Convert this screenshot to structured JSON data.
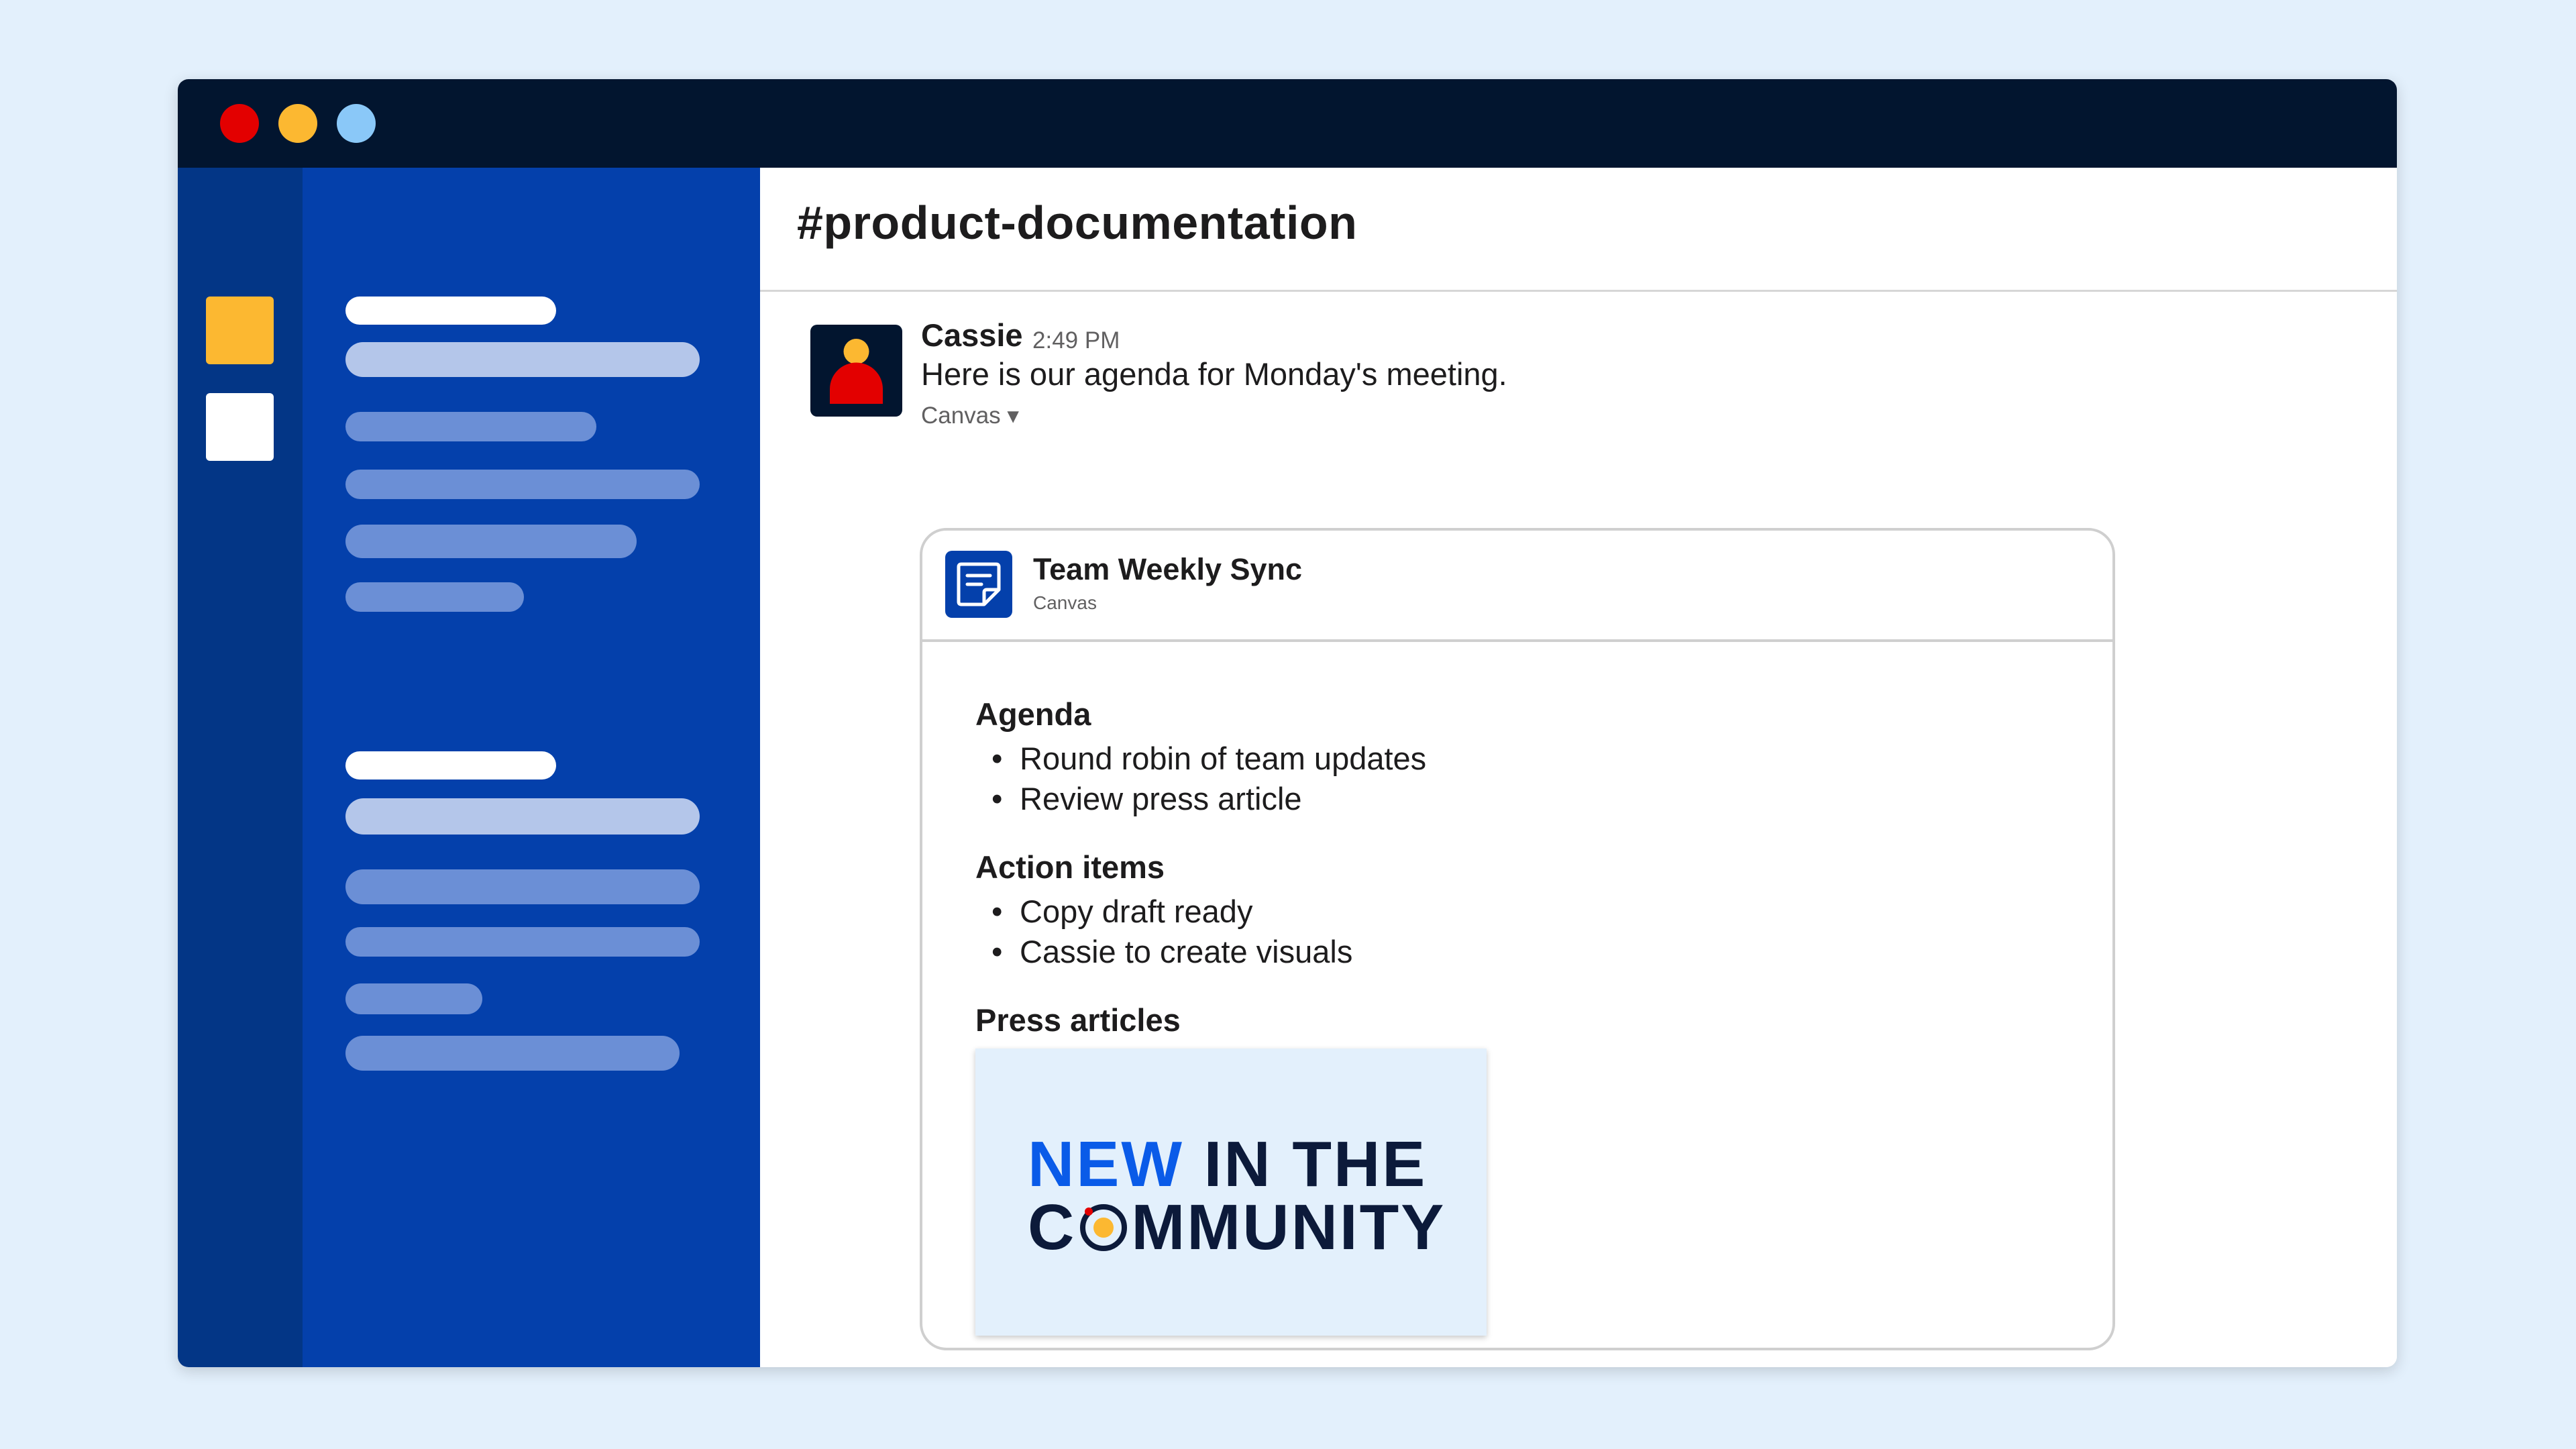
{
  "window": {
    "traffic_lights": [
      {
        "name": "close",
        "color": "#e30000"
      },
      {
        "name": "minimize",
        "color": "#fcb831"
      },
      {
        "name": "zoom",
        "color": "#8ac8f8"
      }
    ]
  },
  "colors": {
    "titlebar": "#02152f",
    "workspace_rail": "#033686",
    "sidebar": "#0440ab",
    "accent_blue": "#0a5be8",
    "workspace_yellow": "#fcb831",
    "avatar_head": "#fcb831",
    "avatar_body": "#e30000"
  },
  "workspaces": [
    {
      "name": "workspace-1",
      "color": "#fcb831"
    },
    {
      "name": "workspace-2",
      "color": "#ffffff"
    }
  ],
  "channel": {
    "title": "#product-documentation"
  },
  "message": {
    "author": "Cassie",
    "time": "2:49 PM",
    "text": "Here is our agenda for Monday's meeting.",
    "canvas_toggle": "Canvas ▾"
  },
  "canvas": {
    "icon": "canvas-doc-icon",
    "title": "Team Weekly Sync",
    "subtitle": "Canvas",
    "sections": [
      {
        "heading": "Agenda",
        "items": [
          "Round robin of team updates",
          "Review press article"
        ]
      },
      {
        "heading": "Action items",
        "items": [
          "Copy draft ready",
          "Cassie to create visuals"
        ]
      },
      {
        "heading": "Press articles",
        "items": []
      }
    ],
    "press_image": {
      "line1_accent": "NEW",
      "line1_rest": " IN THE",
      "line2_start": "C",
      "line2_end": "MMUNITY"
    }
  }
}
